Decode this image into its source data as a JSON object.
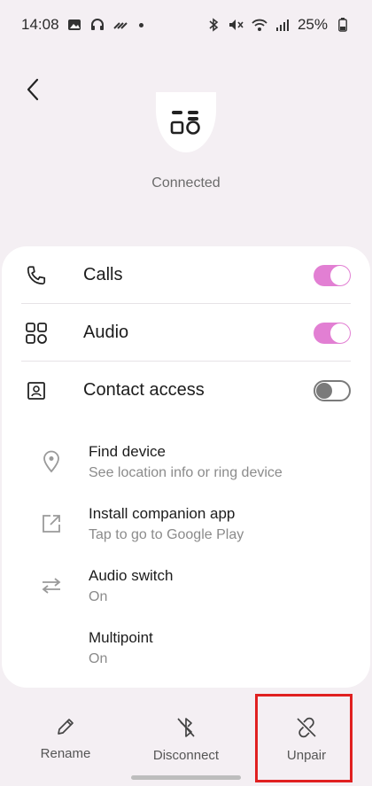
{
  "status_bar": {
    "time": "14:08",
    "battery": "25%",
    "icons": [
      "image-icon",
      "headphones-icon",
      "link-icon",
      "dot",
      "bluetooth-icon",
      "mute-icon",
      "wifi-icon",
      "signal-icon",
      "battery-icon"
    ]
  },
  "device": {
    "status": "Connected"
  },
  "toggles": [
    {
      "label": "Calls",
      "icon": "phone-icon",
      "state": true
    },
    {
      "label": "Audio",
      "icon": "audio-grid-icon",
      "state": true
    },
    {
      "label": "Contact access",
      "icon": "contact-icon",
      "state": false
    }
  ],
  "items": [
    {
      "title": "Find device",
      "subtitle": "See location info or ring device",
      "icon": "location-pin-icon"
    },
    {
      "title": "Install companion app",
      "subtitle": "Tap to go to Google Play",
      "icon": "external-link-icon"
    },
    {
      "title": "Audio switch",
      "subtitle": "On",
      "icon": "swap-arrows-icon"
    },
    {
      "title": "Multipoint",
      "subtitle": "On",
      "icon": ""
    }
  ],
  "actions": {
    "rename": "Rename",
    "disconnect": "Disconnect",
    "unpair": "Unpair"
  },
  "colors": {
    "toggle_on": "#e27fd3",
    "highlight": "#e02020",
    "background": "#f4eff3"
  }
}
